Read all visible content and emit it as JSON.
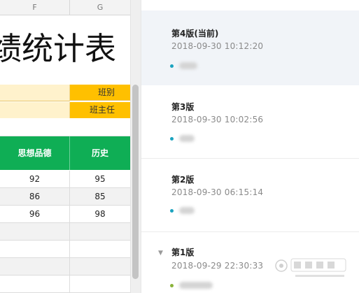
{
  "sheet": {
    "columns": [
      "F",
      "G"
    ],
    "title": "绩统计表",
    "info_labels": [
      "班别",
      "班主任"
    ],
    "header_cells": [
      "思想品德",
      "历史"
    ],
    "rows": [
      [
        "92",
        "95"
      ],
      [
        "86",
        "85"
      ],
      [
        "96",
        "98"
      ]
    ],
    "colors": {
      "header_green": "#0fae55",
      "gold": "#ffc000",
      "light_yellow": "#fff2cc"
    }
  },
  "history": {
    "versions": [
      {
        "label": "第4版(当前)",
        "time": "2018-09-30 10:12:20",
        "current": true
      },
      {
        "label": "第3版",
        "time": "2018-09-30 10:02:56",
        "current": false
      },
      {
        "label": "第2版",
        "time": "2018-09-30 06:15:14",
        "current": false
      },
      {
        "label": "第1版",
        "time": "2018-09-29 22:30:33",
        "current": false,
        "collapsible": true,
        "expand_icon": "caret-down-icon"
      }
    ],
    "accent": "#1ba3bf"
  }
}
